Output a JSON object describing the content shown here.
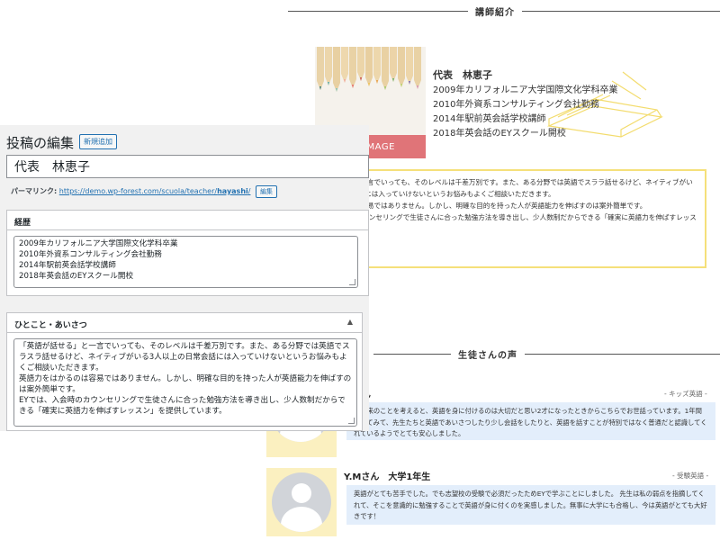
{
  "teacher_section": {
    "heading": "講師紹介",
    "no_image": "NO IMAGE",
    "name": "代表　林恵子",
    "history": [
      "2009年カリフォルニア大学国際文化学科卒業",
      "2010年外資系コンサルティング会社勤務",
      "2014年駅前英会話学校講師",
      "2018年英会話のEYスクール開校"
    ],
    "message": [
      "「英語が話せる」と一言でいっても、そのレベルは千差万別です。また、ある分野では英語でスララ話せるけど、ネイティブがいる3人以上の日常会話には入っていけないというお悩みもよくご相談いただきます。",
      "英語力をはかるのは容易ではありません。しかし、明確な目的を持った人が英語能力を伸ばすのは案外簡単です。",
      "EYでは、入会時のカウンセリングで生徒さんに合った勉強方法を導き出し、少人数制だからできる「確実に英語力を伸ばすレッスン」を提供しています。"
    ]
  },
  "voices_section": {
    "heading": "生徒さんの声",
    "items": [
      {
        "name": "ん",
        "tag": "- キッズ英語 -",
        "text": "の将来のことを考えると、英語を身に付けるのは大切だと思い2才になったときからこちらでお世話っています。1年間通ってみて、先生たちと英語であいさつしたり少し会話をしたりと、英語を話すことが特別ではなく普通だと認識してくれているようでとても安心しました。"
      },
      {
        "name": "Y.Mさん　大学1年生",
        "tag": "- 受験英語 -",
        "text": "英語がとても苦手でした。でも志望校の受験で必須だったためEYで学ぶことにしました。 先生は私の弱点を指摘してくれて、そこを意識的に勉強することで英語が身に付くのを実感しました。無事に大学にも合格し、今は英語がとても大好きです！"
      }
    ]
  },
  "admin": {
    "page_title": "投稿の編集",
    "new_button": "新規追加",
    "post_title": "代表　林恵子",
    "permalink_label": "パーマリンク:",
    "permalink_base": "https://demo.wp-forest.com/scuola/teacher/",
    "permalink_slug": "hayashi",
    "permalink_tail": "/",
    "edit_button": "編集",
    "history_box": {
      "title": "経歴",
      "lines": [
        "2009年カリフォルニア大学国際文化学科卒業",
        "2010年外資系コンサルティング会社勤務",
        "2014年駅前英会話学校講師",
        "2018年英会話のEYスクール開校"
      ]
    },
    "greeting_box": {
      "title": "ひとこと・あいさつ",
      "toggle": "▲",
      "lines": [
        "「英語が話せる」と一言でいっても、そのレベルは千差万別です。また、ある分野では英語でスラスラ話せるけど、ネイティブがいる3人以上の日常会話には入っていけないというお悩みもよくご相談いただきます。",
        "英語力をはかるのは容易ではありません。しかし、明確な目的を持った人が英語能力を伸ばすのは案外簡単です。",
        "EYでは、入会時のカウンセリングで生徒さんに合った勉強方法を導き出し、少人数制だからできる「確実に英語力を伸ばすレッスン」を提供しています。"
      ]
    }
  },
  "colors": {
    "accent_yellow": "#f5e07a",
    "noimage_red": "#e07478",
    "voice_blue": "#e3eefb",
    "wp_link": "#2271b1"
  }
}
